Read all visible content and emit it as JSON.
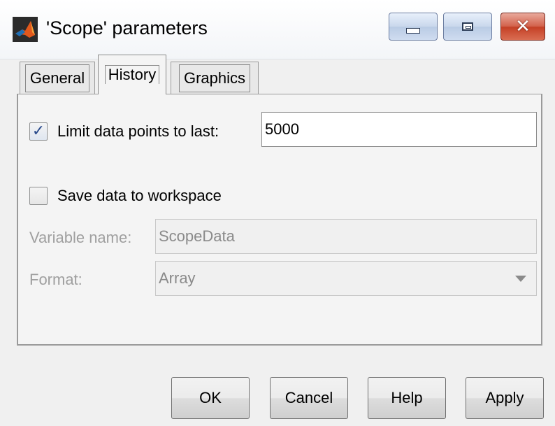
{
  "window": {
    "title": "'Scope' parameters",
    "icon": "matlab-icon",
    "controls": [
      "minimize-icon",
      "maximize-icon",
      "close-icon"
    ],
    "close_glyph": "✕"
  },
  "tabs": [
    {
      "label": "General",
      "active": false
    },
    {
      "label": "History",
      "active": true
    },
    {
      "label": "Graphics",
      "active": false
    }
  ],
  "history": {
    "limit": {
      "checked": true,
      "label": "Limit data points to last:",
      "value": "5000"
    },
    "save": {
      "checked": false,
      "label": "Save data to workspace"
    },
    "variable": {
      "label": "Variable name:",
      "value": "ScopeData"
    },
    "format": {
      "label": "Format:",
      "value": "Array"
    }
  },
  "buttons": {
    "ok": "OK",
    "cancel": "Cancel",
    "help": "Help",
    "apply": "Apply"
  },
  "colors": {
    "check": "#2a4b8c",
    "close_button": "#c43f25",
    "disabled_text": "#9f9f9f"
  }
}
